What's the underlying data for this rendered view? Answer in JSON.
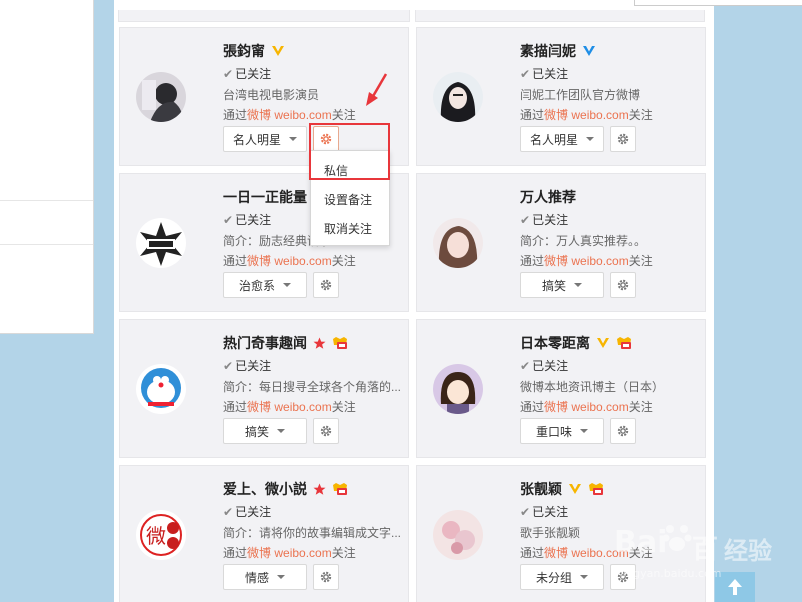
{
  "colors": {
    "accent": "#eb7350",
    "highlight": "#e8363b",
    "vip_gold": "#f7b500",
    "vip_blue": "#1f8ee6",
    "page_bg": "#b3d4e8"
  },
  "common": {
    "followed": "已关注",
    "via_prefix": "通过",
    "via_site": "微博 weibo.com",
    "via_suffix": "关注"
  },
  "cards": [
    {
      "name": "張鈞甯",
      "badges": [
        "vip-gold-icon"
      ],
      "desc": "台湾电视电影演员",
      "group": "名人明星"
    },
    {
      "name": "素描闫妮",
      "badges": [
        "vip-blue-icon"
      ],
      "desc": "闫妮工作团队官方微博",
      "group": "名人明星"
    },
    {
      "name": "一日一正能量",
      "badges": [],
      "desc": "简介：励志经典语录…",
      "group": "治愈系"
    },
    {
      "name": "万人推荐",
      "badges": [],
      "desc": "简介：万人真实推荐。。",
      "group": "搞笑"
    },
    {
      "name": "热门奇事趣闻",
      "badges": [
        "red-star-icon",
        "vip-level-icon"
      ],
      "desc": "简介：每日搜寻全球各个角落的...",
      "group": "搞笑"
    },
    {
      "name": "日本零距离",
      "badges": [
        "vip-gold-icon",
        "vip-level-icon"
      ],
      "desc": "微博本地资讯博主（日本）",
      "group": "重口味"
    },
    {
      "name": "爱上、微小説",
      "badges": [
        "red-star-icon",
        "vip-level-icon"
      ],
      "desc": "简介：请将你的故事编辑成文字...",
      "group": "情感"
    },
    {
      "name": "张靓颖",
      "badges": [
        "vip-gold-icon",
        "vip-level-icon"
      ],
      "desc": "歌手张靓颖",
      "group": "未分组"
    }
  ],
  "menu": {
    "items": [
      "私信",
      "设置备注",
      "取消关注"
    ]
  },
  "watermark": {
    "brand": "Bai",
    "brand_end": "百",
    "site": "jingyan.baidu.com",
    "label": "经验"
  }
}
